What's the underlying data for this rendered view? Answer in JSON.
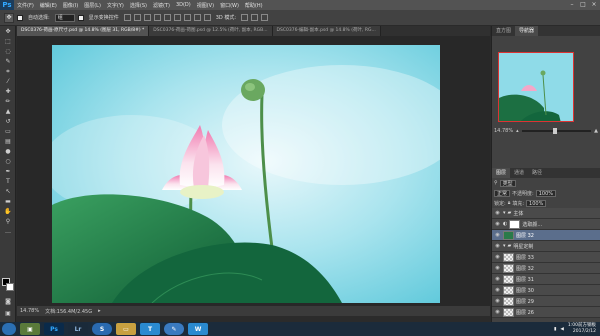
{
  "app": {
    "logo": "Ps"
  },
  "menu": [
    "文件(F)",
    "编辑(E)",
    "图像(I)",
    "图层(L)",
    "文字(Y)",
    "选择(S)",
    "滤镜(T)",
    "3D(D)",
    "视图(V)",
    "窗口(W)",
    "帮助(H)"
  ],
  "options": {
    "auto_select_label": "自动选择:",
    "auto_select_value": "组",
    "show_transform_label": "显示变换控件",
    "mode_label": "3D 模式:"
  },
  "doc_tabs": [
    "DSC0376-荷画-原尺寸.psd @ 14.8% (图层 31, RGB/8#) *",
    "DSC0376-荷画-荷图.psd @ 12.5% (荷叶, 副本, RGB...",
    "DSC0376-编辑-副本.psd @ 14.8% (荷叶, RG..."
  ],
  "status": {
    "zoom": "14.78%",
    "doc_size": "文档:156.4M/2.45G"
  },
  "panel": {
    "tab_histogram": "直方图",
    "tab_navigator": "导航器",
    "nav_zoom": "14.78%",
    "nav_slider_level": 0.45,
    "layers_tabs": [
      "图层",
      "通道",
      "路径"
    ],
    "filter_label": "类型",
    "blend_mode": "正常",
    "opacity_label": "不透明度:",
    "opacity_value": "100%",
    "lock_label": "锁定:",
    "fill_label": "填充:",
    "fill_value": "100%",
    "layers": [
      {
        "name": "主体",
        "kind": "group"
      },
      {
        "name": "选取颜...",
        "kind": "adjust"
      },
      {
        "name": "图层 32",
        "kind": "layer",
        "selected": true
      },
      {
        "name": "明星定制",
        "kind": "group"
      },
      {
        "name": "图层 33",
        "kind": "layer"
      },
      {
        "name": "图层 32",
        "kind": "layer"
      },
      {
        "name": "图层 31",
        "kind": "layer"
      },
      {
        "name": "图层 30",
        "kind": "layer"
      },
      {
        "name": "图层 29",
        "kind": "layer"
      },
      {
        "name": "图层 26",
        "kind": "layer"
      }
    ]
  },
  "taskbar": {
    "apps": [
      "Ps",
      "Lr",
      "S",
      "T",
      "W"
    ],
    "clock_time": "1:00前方钢板",
    "clock_date": "2017/2/12"
  },
  "colors": {
    "accent": "#31a8ff",
    "selected": "#5b6e8c",
    "sky": "#7fd6e6",
    "leaf": "#1f7a48",
    "petal": "#f4a7c8"
  }
}
